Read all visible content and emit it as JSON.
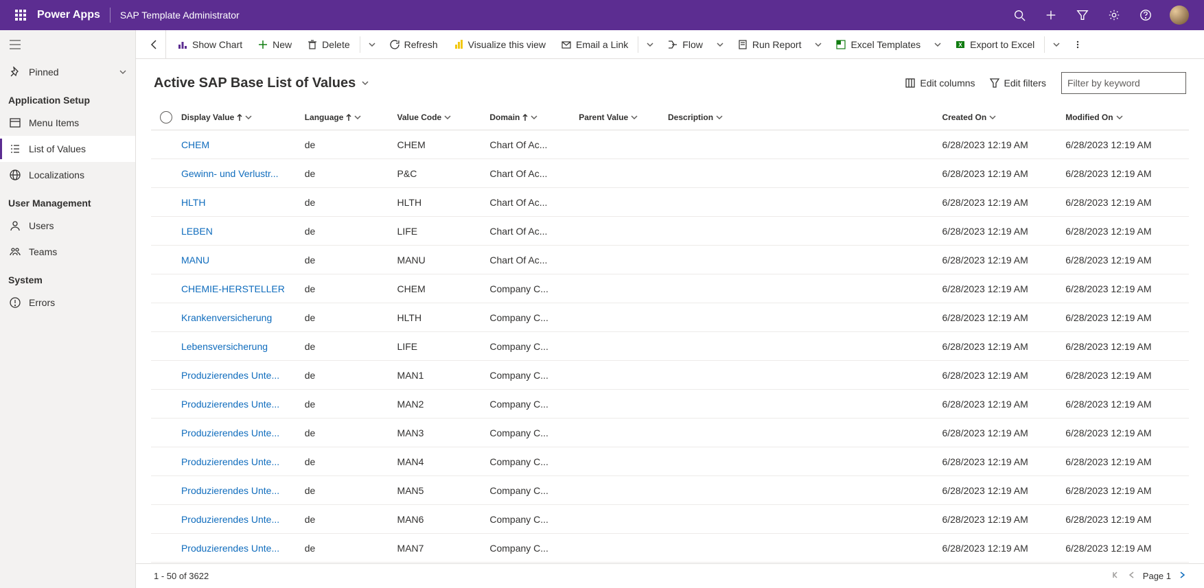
{
  "header": {
    "brand": "Power Apps",
    "env": "SAP Template Administrator"
  },
  "sidebar": {
    "pinned": "Pinned",
    "sections": {
      "app_setup": "Application Setup",
      "user_mgmt": "User Management",
      "system": "System"
    },
    "items": {
      "menu_items": "Menu Items",
      "list_of_values": "List of Values",
      "localizations": "Localizations",
      "users": "Users",
      "teams": "Teams",
      "errors": "Errors"
    }
  },
  "commands": {
    "show_chart": "Show Chart",
    "new": "New",
    "delete": "Delete",
    "refresh": "Refresh",
    "visualize": "Visualize this view",
    "email_link": "Email a Link",
    "flow": "Flow",
    "run_report": "Run Report",
    "excel_templates": "Excel Templates",
    "export_excel": "Export to Excel"
  },
  "view": {
    "title": "Active SAP Base List of Values",
    "edit_columns": "Edit columns",
    "edit_filters": "Edit filters",
    "filter_placeholder": "Filter by keyword"
  },
  "columns": {
    "display_value": "Display Value",
    "language": "Language",
    "value_code": "Value Code",
    "domain": "Domain",
    "parent_value": "Parent Value",
    "description": "Description",
    "created_on": "Created On",
    "modified_on": "Modified On"
  },
  "rows": [
    {
      "display": "CHEM",
      "lang": "de",
      "code": "CHEM",
      "domain": "Chart Of Ac...",
      "parent": "",
      "desc": "",
      "created": "6/28/2023 12:19 AM",
      "modified": "6/28/2023 12:19 AM"
    },
    {
      "display": "Gewinn- und Verlustr...",
      "lang": "de",
      "code": "P&C",
      "domain": "Chart Of Ac...",
      "parent": "",
      "desc": "",
      "created": "6/28/2023 12:19 AM",
      "modified": "6/28/2023 12:19 AM"
    },
    {
      "display": "HLTH",
      "lang": "de",
      "code": "HLTH",
      "domain": "Chart Of Ac...",
      "parent": "",
      "desc": "",
      "created": "6/28/2023 12:19 AM",
      "modified": "6/28/2023 12:19 AM"
    },
    {
      "display": "LEBEN",
      "lang": "de",
      "code": "LIFE",
      "domain": "Chart Of Ac...",
      "parent": "",
      "desc": "",
      "created": "6/28/2023 12:19 AM",
      "modified": "6/28/2023 12:19 AM"
    },
    {
      "display": "MANU",
      "lang": "de",
      "code": "MANU",
      "domain": "Chart Of Ac...",
      "parent": "",
      "desc": "",
      "created": "6/28/2023 12:19 AM",
      "modified": "6/28/2023 12:19 AM"
    },
    {
      "display": "CHEMIE-HERSTELLER",
      "lang": "de",
      "code": "CHEM",
      "domain": "Company C...",
      "parent": "",
      "desc": "",
      "created": "6/28/2023 12:19 AM",
      "modified": "6/28/2023 12:19 AM"
    },
    {
      "display": "Krankenversicherung",
      "lang": "de",
      "code": "HLTH",
      "domain": "Company C...",
      "parent": "",
      "desc": "",
      "created": "6/28/2023 12:19 AM",
      "modified": "6/28/2023 12:19 AM"
    },
    {
      "display": "Lebensversicherung",
      "lang": "de",
      "code": "LIFE",
      "domain": "Company C...",
      "parent": "",
      "desc": "",
      "created": "6/28/2023 12:19 AM",
      "modified": "6/28/2023 12:19 AM"
    },
    {
      "display": "Produzierendes Unte...",
      "lang": "de",
      "code": "MAN1",
      "domain": "Company C...",
      "parent": "",
      "desc": "",
      "created": "6/28/2023 12:19 AM",
      "modified": "6/28/2023 12:19 AM"
    },
    {
      "display": "Produzierendes Unte...",
      "lang": "de",
      "code": "MAN2",
      "domain": "Company C...",
      "parent": "",
      "desc": "",
      "created": "6/28/2023 12:19 AM",
      "modified": "6/28/2023 12:19 AM"
    },
    {
      "display": "Produzierendes Unte...",
      "lang": "de",
      "code": "MAN3",
      "domain": "Company C...",
      "parent": "",
      "desc": "",
      "created": "6/28/2023 12:19 AM",
      "modified": "6/28/2023 12:19 AM"
    },
    {
      "display": "Produzierendes Unte...",
      "lang": "de",
      "code": "MAN4",
      "domain": "Company C...",
      "parent": "",
      "desc": "",
      "created": "6/28/2023 12:19 AM",
      "modified": "6/28/2023 12:19 AM"
    },
    {
      "display": "Produzierendes Unte...",
      "lang": "de",
      "code": "MAN5",
      "domain": "Company C...",
      "parent": "",
      "desc": "",
      "created": "6/28/2023 12:19 AM",
      "modified": "6/28/2023 12:19 AM"
    },
    {
      "display": "Produzierendes Unte...",
      "lang": "de",
      "code": "MAN6",
      "domain": "Company C...",
      "parent": "",
      "desc": "",
      "created": "6/28/2023 12:19 AM",
      "modified": "6/28/2023 12:19 AM"
    },
    {
      "display": "Produzierendes Unte...",
      "lang": "de",
      "code": "MAN7",
      "domain": "Company C...",
      "parent": "",
      "desc": "",
      "created": "6/28/2023 12:19 AM",
      "modified": "6/28/2023 12:19 AM"
    }
  ],
  "footer": {
    "range": "1 - 50 of 3622",
    "page": "Page 1"
  }
}
